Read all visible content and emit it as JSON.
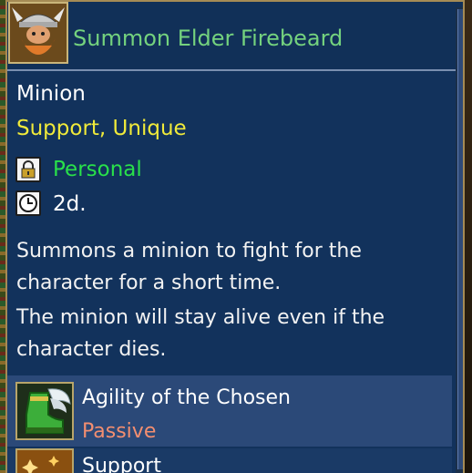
{
  "ability": {
    "title": "Summon Elder Firebeard",
    "type": "Minion",
    "tags": "Support, Unique",
    "scope": "Personal",
    "cooldown": "2d.",
    "description": [
      "Summons a minion to fight for the",
      "character for a short time.",
      "The minion will stay alive even if the",
      "character dies."
    ]
  },
  "linked": [
    {
      "name": "Agility of the Chosen",
      "type": "Passive",
      "icon": "winged-boot-icon"
    },
    {
      "name": "Support",
      "icon": "sparkle-icon"
    }
  ],
  "colors": {
    "title": "#74d27e",
    "tags": "#f0ea3a",
    "scope": "#29e04a",
    "passive": "#f38e70",
    "panel": "#12325c"
  }
}
